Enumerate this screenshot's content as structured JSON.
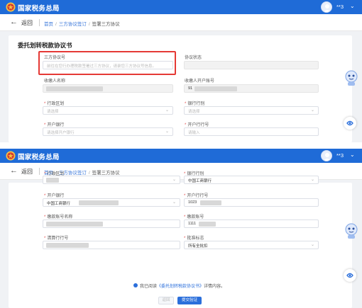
{
  "app": {
    "title": "国家税务总局",
    "user_name": "**3",
    "user_caret": "⌄"
  },
  "nav": {
    "back_label": "返回",
    "breadcrumb": [
      "首页",
      "三方协议签订",
      "签署三方协议"
    ]
  },
  "form": {
    "title": "委托划转税款协议书",
    "agreement_no": {
      "label": "三方协议号",
      "placeholder": "前往在您行办理税款签署过三方协议，请录您三方协议号信息。"
    },
    "agreement_status": {
      "label": "协议状态",
      "value": ""
    },
    "payee_name": {
      "label": "收缴人名称",
      "value": ""
    },
    "payee_account": {
      "label": "收缴人开户账号",
      "value": "91"
    },
    "region": {
      "label": "行政区划",
      "placeholder": "请选择",
      "value": ""
    },
    "bank_line": {
      "label": "银行行别",
      "placeholder": "请选择",
      "value": "中国工商银行"
    },
    "open_bank": {
      "label": "开户银行",
      "placeholder": "请选择开户银行",
      "value": "中国工商银行"
    },
    "open_bank_code": {
      "label": "开户行行号",
      "placeholder": "请输入",
      "value": "1023"
    },
    "payer_account_name": {
      "label": "缴款账号名称",
      "value": ""
    },
    "payer_account_no": {
      "label": "缴款账号",
      "value": "1111"
    },
    "clearing_bank_no": {
      "label": "清算行行号",
      "value": ""
    },
    "approval_flag": {
      "label": "批准标志",
      "value": "所有全批扣"
    }
  },
  "consent": {
    "prefix": "我已阅读",
    "link": "《委托划转税款协议书》",
    "suffix": "详情内容。"
  },
  "buttons": {
    "cancel": "返回",
    "submit": "提交验证"
  },
  "colors": {
    "brand_blue": "#1f6bd7",
    "link_blue": "#3574d9",
    "highlight_red": "#e53935",
    "required_red": "#e34d4d"
  },
  "icons": [
    "tax-bureau-emblem-icon",
    "user-avatar-icon",
    "back-arrow-icon",
    "chevron-down-icon",
    "robot-assistant-icon",
    "helper-float-icon"
  ]
}
